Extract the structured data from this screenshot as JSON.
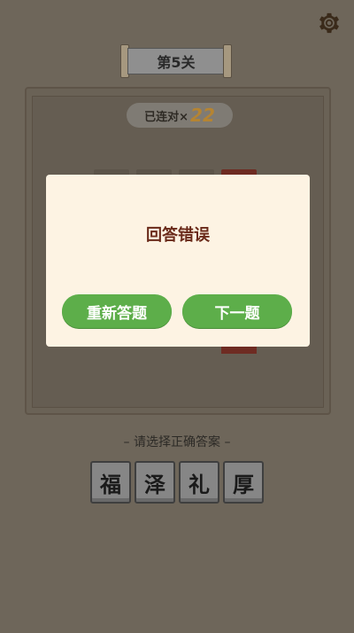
{
  "header": {
    "level_label": "第5关"
  },
  "streak": {
    "label": "已连对×",
    "count": "22"
  },
  "answer_area": {
    "prompt": "– 请选择正确答案 –",
    "choices": [
      "福",
      "泽",
      "礼",
      "厚"
    ]
  },
  "dialog": {
    "title": "回答错误",
    "retry_label": "重新答题",
    "next_label": "下一题"
  },
  "colors": {
    "button_green": "#5dae4a",
    "dialog_bg": "#fdf3e3",
    "title_text": "#6a2a1a"
  }
}
